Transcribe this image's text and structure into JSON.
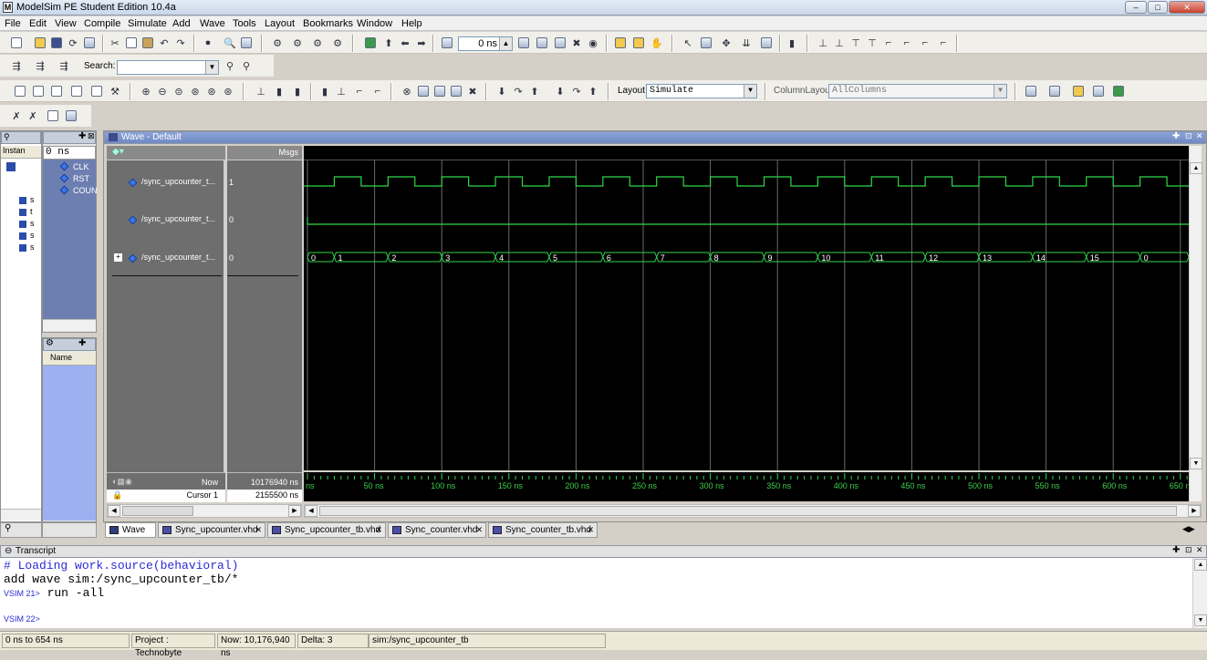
{
  "window": {
    "title": "ModelSim PE Student Edition 10.4a",
    "app_icon": "M",
    "min": "–",
    "max": "□",
    "close": "✕"
  },
  "menu": [
    "File",
    "Edit",
    "View",
    "Compile",
    "Simulate",
    "Add",
    "Wave",
    "Tools",
    "Layout",
    "Bookmarks",
    "Window",
    "Help"
  ],
  "toolbar": {
    "time_value": "0 ns",
    "search_label": "Search:",
    "search_value": "",
    "layout_label": "Layout",
    "layout_value": "Simulate",
    "column_layout_label": "ColumnLayout",
    "column_layout_value": "AllColumns"
  },
  "instance_panel": {
    "header": "Instan",
    "items": [
      "s",
      "t",
      "s",
      "s",
      "s"
    ]
  },
  "objects_panel": {
    "time": "0 ns",
    "signals": [
      "CLK",
      "RST",
      "COUN"
    ]
  },
  "processes_panel": {
    "column": "Name"
  },
  "wave": {
    "title": "Wave - Default",
    "msgs_header": "Msgs",
    "signals": [
      {
        "name": "/sync_upcounter_t...",
        "value": "1"
      },
      {
        "name": "/sync_upcounter_t...",
        "value": "0"
      },
      {
        "name": "/sync_upcounter_t...",
        "value": "0"
      }
    ],
    "counter_values": [
      "0",
      "1",
      "2",
      "3",
      "4",
      "5",
      "6",
      "7",
      "8",
      "9",
      "10",
      "11",
      "12",
      "13",
      "14",
      "15",
      "0"
    ],
    "now_label": "Now",
    "now_value": "10176940 ns",
    "cursor_label": "Cursor 1",
    "cursor_value": "2155500 ns",
    "time_ticks": [
      "ns",
      "50 ns",
      "100 ns",
      "150 ns",
      "200 ns",
      "250 ns",
      "300 ns",
      "350 ns",
      "400 ns",
      "450 ns",
      "500 ns",
      "550 ns",
      "600 ns",
      "650 r"
    ]
  },
  "tabs": [
    "Wave",
    "Sync_upcounter.vhd",
    "Sync_upcounter_tb.vhd",
    "Sync_counter.vhd",
    "Sync_counter_tb.vhd"
  ],
  "transcript": {
    "title": "Transcript",
    "lines": [
      "# Loading work.source(behavioral)",
      "add wave sim:/sync_upcounter_tb/*"
    ],
    "prompt1": "VSIM 21>",
    "cmd1": " run -all",
    "prompt2": "VSIM 22>"
  },
  "status": {
    "range": "0 ns to 654 ns",
    "project": "Project : Technobyte",
    "now": "Now: 10,176,940 ns",
    "delta": "Delta: 3",
    "context": "sim:/sync_upcounter_tb"
  },
  "colors": {
    "wave_green": "#2fd84a",
    "wave_bg": "#000000",
    "signal_panel": "#6e6e6e"
  }
}
